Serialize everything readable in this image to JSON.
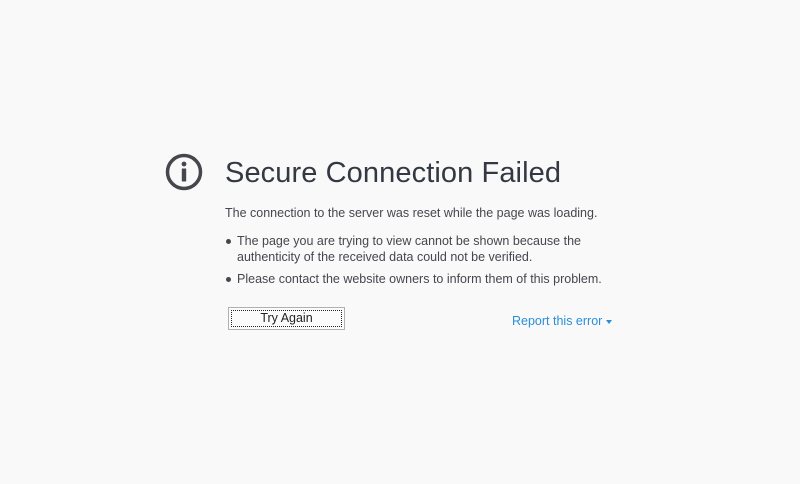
{
  "error": {
    "icon": "info-icon",
    "title": "Secure Connection Failed",
    "summary": "The connection to the server was reset while the page was loading.",
    "details": [
      "The page you are trying to view cannot be shown because the authenticity of the received data could not be verified.",
      "Please contact the website owners to inform them of this problem."
    ]
  },
  "actions": {
    "try_again_label": "Try Again",
    "report_label": "Report this error"
  },
  "colors": {
    "background": "#f9f9fa",
    "title": "#333842",
    "text": "#45474d",
    "link": "#2a8ed6"
  }
}
